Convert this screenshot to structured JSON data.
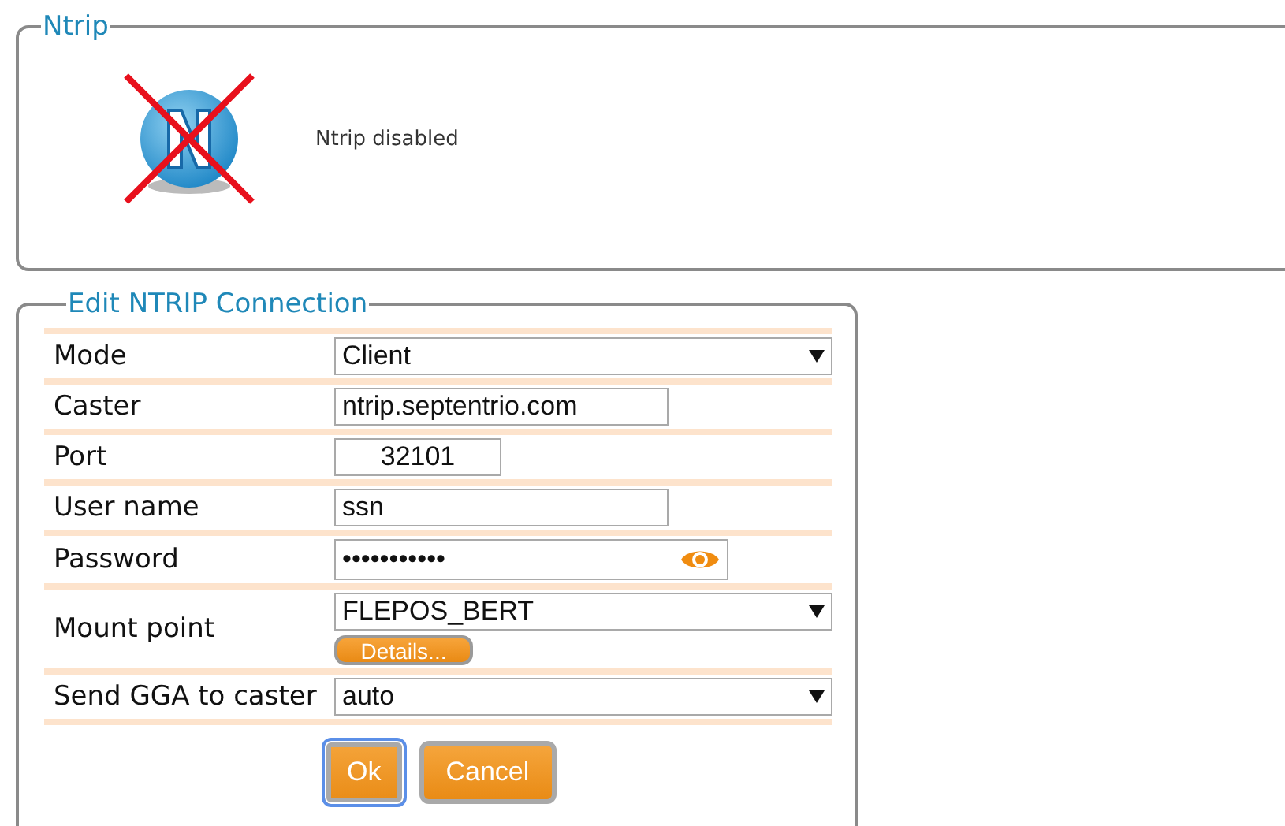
{
  "status_panel": {
    "title": "Ntrip",
    "icon_disabled": true,
    "status": "Ntrip disabled"
  },
  "connection": {
    "title": "Edit NTRIP Connection",
    "rows": [
      {
        "kind": "select",
        "label": "Mode",
        "value": "Client"
      },
      {
        "kind": "text",
        "label": "Caster",
        "value": "ntrip.septentrio.com"
      },
      {
        "kind": "number",
        "label": "Port",
        "value": "32101"
      },
      {
        "kind": "text",
        "label": "User name",
        "value": "ssn"
      },
      {
        "kind": "password",
        "label": "Password",
        "value": "•••••••••••"
      },
      {
        "kind": "select_button",
        "label": "Mount point",
        "value": "FLEPOS_BERT",
        "button": "Details..."
      },
      {
        "kind": "select",
        "label": "Send GGA to caster",
        "value": "auto"
      }
    ],
    "buttons": [
      {
        "label": "Ok",
        "focused": true
      },
      {
        "label": "Cancel",
        "focused": false
      }
    ]
  }
}
